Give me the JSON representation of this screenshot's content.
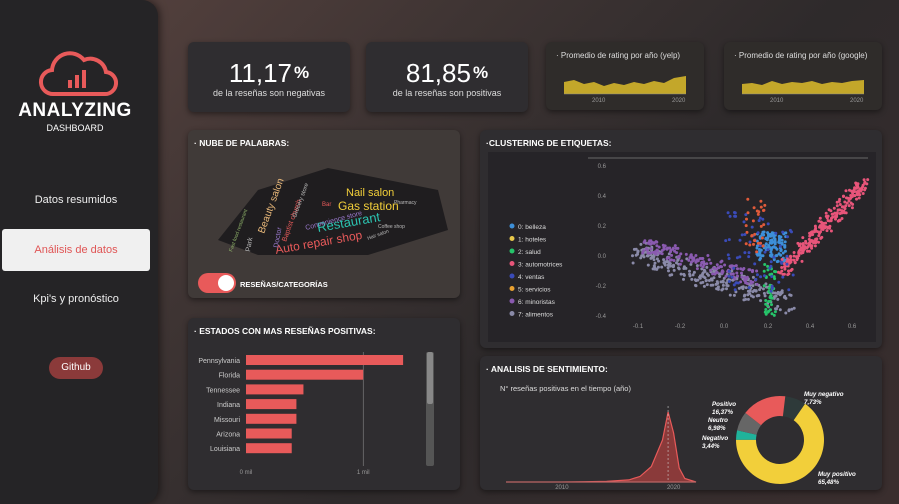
{
  "logo": {
    "title": "ANALYZING",
    "subtitle": "DASHBOARD"
  },
  "nav": {
    "items": [
      "Datos resumidos",
      "Análisis de datos",
      "Kpi's y pronóstico"
    ],
    "active": "Análisis de datos",
    "github": "Github"
  },
  "kpis": [
    {
      "value": "11,17",
      "unit": "%",
      "label": "de la reseñas son negativas"
    },
    {
      "value": "81,85",
      "unit": "%",
      "label": "de la reseñas son positivas"
    }
  ],
  "sparks": [
    {
      "title": "Promedio de rating por año (yelp)",
      "ticks": [
        "2010",
        "2020"
      ]
    },
    {
      "title": "Promedio de rating por año (google)",
      "ticks": [
        "2010",
        "2020"
      ]
    }
  ],
  "wordcloud": {
    "title": "NUBE DE PALABRAS:",
    "toggle_label": "RESEÑAS/CATEGORÍAS",
    "words": [
      "Nail salon",
      "Gas station",
      "Restaurant",
      "Auto repair shop",
      "Beauty salon",
      "Convenience store",
      "Baptist church",
      "Doctor",
      "Grocery store",
      "Bar",
      "Fast food restaurant",
      "Park",
      "Hair salon",
      "Coffee shop",
      "Pharmacy"
    ]
  },
  "statesChart": {
    "title": "ESTADOS CON MAS RESEÑAS POSITIVAS:"
  },
  "clustering": {
    "title": "CLUSTERING DE ETIQUETAS:",
    "legend": [
      "0: belleza",
      "1: hoteles",
      "2: salud",
      "3: automotrices",
      "4: ventas",
      "5: servicios",
      "6: minoristas",
      "7: alimentos"
    ]
  },
  "sentiment": {
    "title": "ANALISIS DE SENTIMIENTO:",
    "subtitle": "N° reseñas positivas en el tiempo (año)",
    "time_ticks": [
      "2010",
      "2020"
    ],
    "donut": [
      {
        "label": "Muy positivo",
        "pct": "65,48%",
        "value": 65.48,
        "color": "#f2cf3a"
      },
      {
        "label": "Positivo",
        "pct": "16,37%",
        "value": 16.37,
        "color": "#e85a5a"
      },
      {
        "label": "Neutro",
        "pct": "6,98%",
        "value": 6.98,
        "color": "#666"
      },
      {
        "label": "Negativo",
        "pct": "3,44%",
        "value": 3.44,
        "color": "#1fb39b"
      },
      {
        "label": "Muy negativo",
        "pct": "7,73%",
        "value": 7.73,
        "color": "#2e3a3a"
      }
    ]
  },
  "chart_data": [
    {
      "type": "bar",
      "title": "ESTADOS CON MAS RESEÑAS POSITIVAS:",
      "orientation": "horizontal",
      "categories": [
        "Pennsylvania",
        "Florida",
        "Tennessee",
        "Indiana",
        "Missouri",
        "Arizona",
        "Louisiana"
      ],
      "values": [
        1.34,
        1.0,
        0.49,
        0.43,
        0.43,
        0.39,
        0.39
      ],
      "x_ticks": [
        "0 mil",
        "1 mil"
      ],
      "xlim": [
        0,
        1.45
      ],
      "color": "#e85a5a"
    },
    {
      "type": "scatter",
      "title": "CLUSTERING DE ETIQUETAS:",
      "x_ticks": [
        "-0.1",
        "-0.2",
        "0.0",
        "0.2",
        "0.4",
        "0.6"
      ],
      "y_ticks": [
        "0.6",
        "0.4",
        "0.2",
        "0.0",
        "-0.2",
        "-0.4"
      ]
    },
    {
      "type": "area",
      "title": "N° reseñas positivas en el tiempo (año)",
      "x": [
        2005,
        2008,
        2010,
        2012,
        2014,
        2016,
        2017,
        2018,
        2019,
        2019.5,
        2020,
        2020.5,
        2021,
        2022
      ],
      "values": [
        0,
        0,
        0,
        0.5,
        1,
        3,
        8,
        22,
        60,
        100,
        70,
        20,
        5,
        0
      ],
      "x_ticks": [
        "2010",
        "2020"
      ],
      "color": "#e85a5a"
    }
  ]
}
